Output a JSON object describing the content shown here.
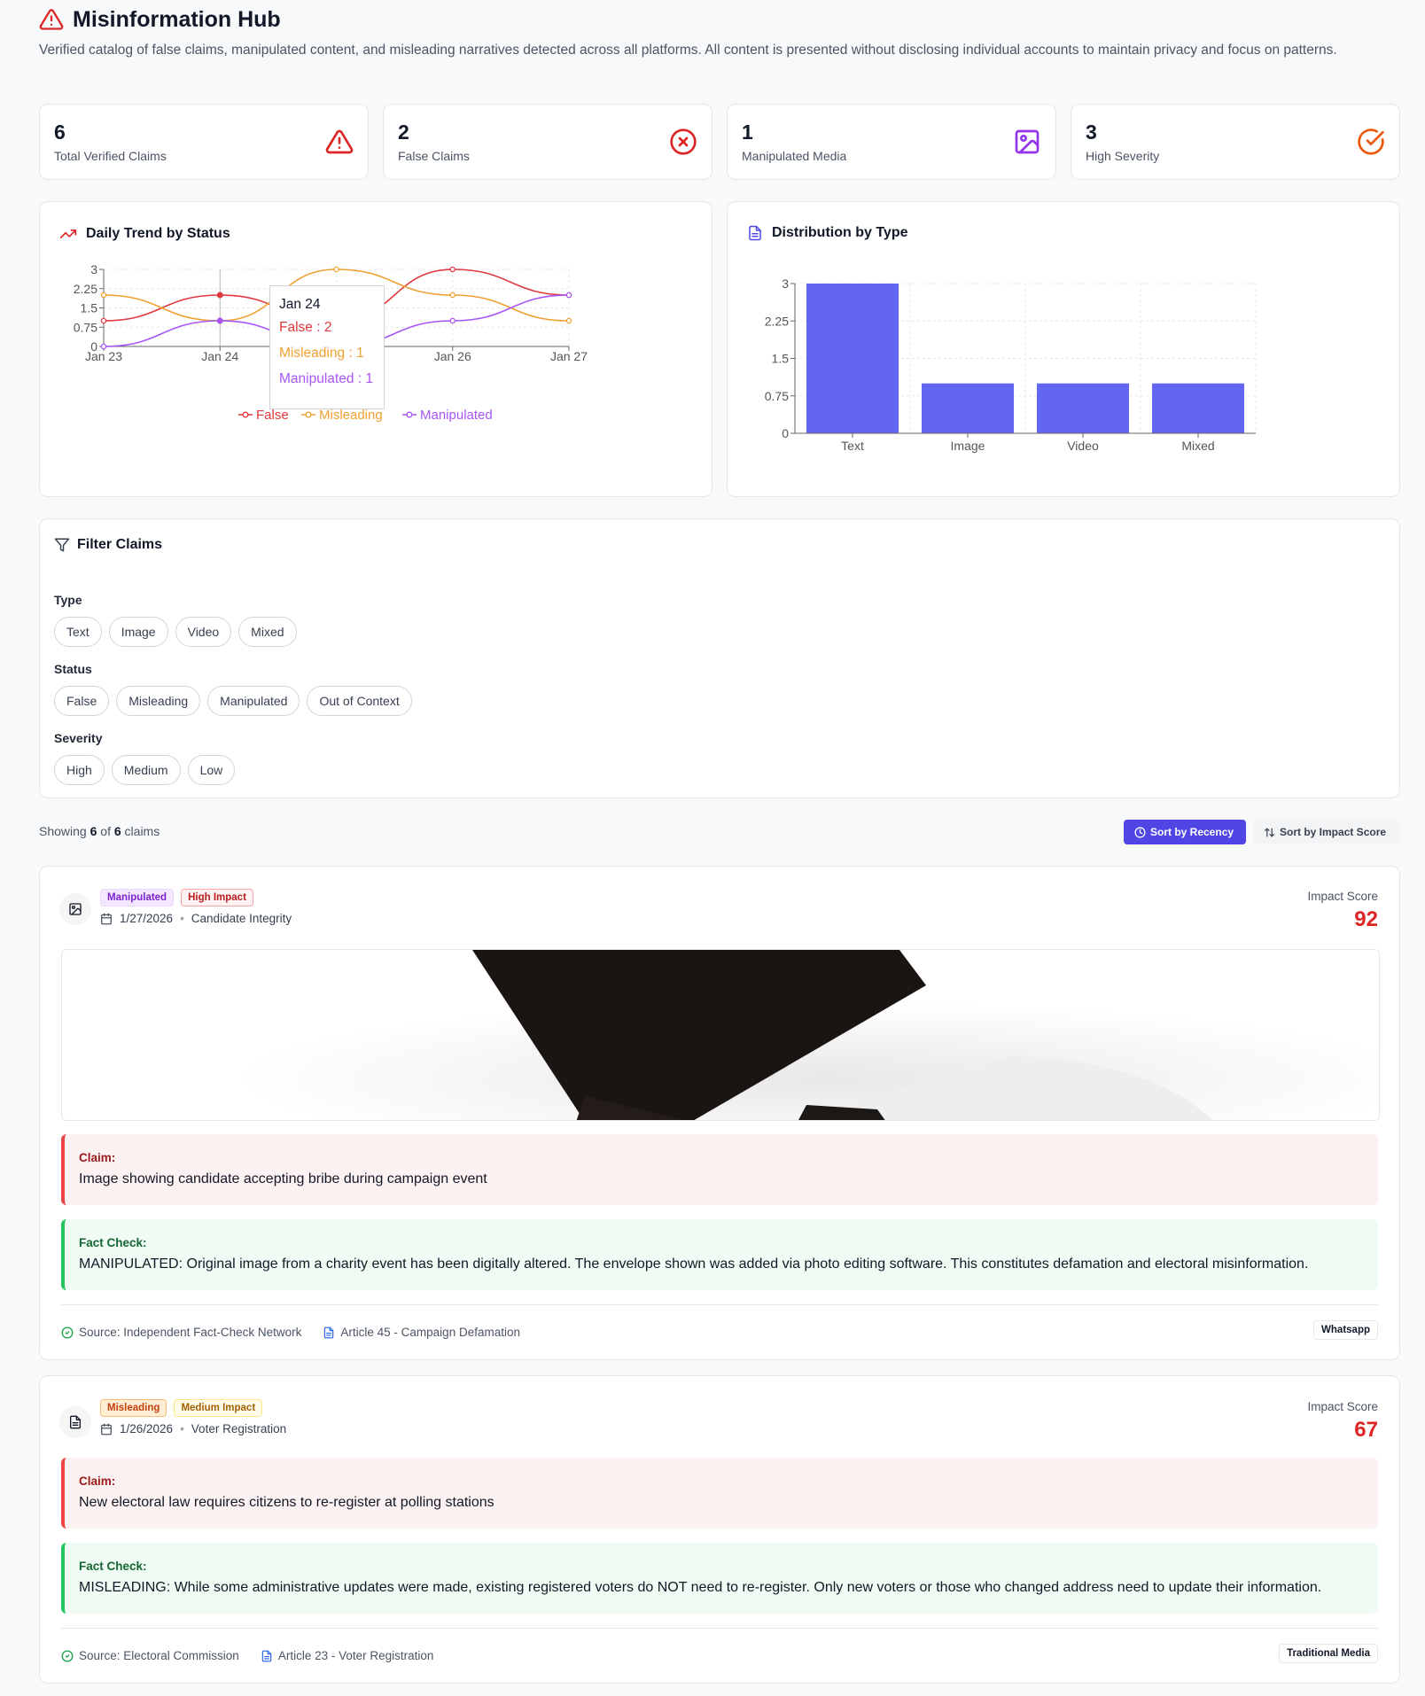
{
  "header": {
    "title": "Misinformation Hub",
    "subtitle": "Verified catalog of false claims, manipulated content, and misleading narratives detected across all platforms. All content is presented without disclosing individual accounts to maintain privacy and focus on patterns."
  },
  "stats": [
    {
      "value": "6",
      "label": "Total Verified Claims",
      "icon": "warning-triangle-icon",
      "color": "#dc2626"
    },
    {
      "value": "2",
      "label": "False Claims",
      "icon": "x-circle-icon",
      "color": "#dc2626"
    },
    {
      "value": "1",
      "label": "Manipulated Media",
      "icon": "image-icon",
      "color": "#9333ea"
    },
    {
      "value": "3",
      "label": "High Severity",
      "icon": "check-circle-icon",
      "color": "#ea580c"
    }
  ],
  "trend": {
    "title": "Daily Trend by Status",
    "tooltip": {
      "date": "Jan 24",
      "false": "False : 2",
      "misleading": "Misleading : 1",
      "manipulated": "Manipulated : 1"
    }
  },
  "distribution": {
    "title": "Distribution by Type"
  },
  "chart_data": [
    {
      "type": "line",
      "title": "Daily Trend by Status",
      "x": [
        "Jan 23",
        "Jan 24",
        "Jan 25",
        "Jan 26",
        "Jan 27"
      ],
      "y_ticks": [
        "0",
        "0.75",
        "1.5",
        "2.25",
        "3"
      ],
      "ylim": [
        0,
        3
      ],
      "series": [
        {
          "name": "False",
          "values": [
            1,
            2,
            1,
            3,
            2
          ],
          "color": "#e0393e"
        },
        {
          "name": "Misleading",
          "values": [
            2,
            1,
            3,
            2,
            1
          ],
          "color": "#f0a030"
        },
        {
          "name": "Manipulated",
          "values": [
            0,
            1,
            0,
            1,
            2
          ],
          "color": "#a855f7"
        }
      ],
      "grid": true,
      "legend": "bottom"
    },
    {
      "type": "bar",
      "title": "Distribution by Type",
      "categories": [
        "Text",
        "Image",
        "Video",
        "Mixed"
      ],
      "values": [
        3,
        1,
        1,
        1
      ],
      "y_ticks": [
        "0",
        "0.75",
        "1.5",
        "2.25",
        "3"
      ],
      "ylim": [
        0,
        3
      ],
      "color": "#6366f1",
      "grid": true
    }
  ],
  "filters": {
    "title": "Filter Claims",
    "type_label": "Type",
    "type_options": [
      "Text",
      "Image",
      "Video",
      "Mixed"
    ],
    "status_label": "Status",
    "status_options": [
      "False",
      "Misleading",
      "Manipulated",
      "Out of Context"
    ],
    "severity_label": "Severity",
    "severity_options": [
      "High",
      "Medium",
      "Low"
    ]
  },
  "results": {
    "showing_prefix": "Showing",
    "shown": "6",
    "of": "of",
    "total": "6",
    "suffix": "claims",
    "sort_recency": "Sort by Recency",
    "sort_impact": "Sort by Impact Score"
  },
  "claims": [
    {
      "status_badge": "Manipulated",
      "impact_badge": "High Impact",
      "date": "1/27/2026",
      "category": "Candidate Integrity",
      "impact_label": "Impact Score",
      "impact_score": "92",
      "claim_title": "Claim:",
      "claim_text": "Image showing candidate accepting bribe during campaign event",
      "fact_title": "Fact Check:",
      "fact_text": "MANIPULATED: Original image from a charity event has been digitally altered. The envelope shown was added via photo editing software. This constitutes defamation and electoral misinformation.",
      "source": "Source: Independent Fact-Check Network",
      "article": "Article 45 - Campaign Defamation",
      "platform": "Whatsapp"
    },
    {
      "status_badge": "Misleading",
      "impact_badge": "Medium Impact",
      "date": "1/26/2026",
      "category": "Voter Registration",
      "impact_label": "Impact Score",
      "impact_score": "67",
      "claim_title": "Claim:",
      "claim_text": "New electoral law requires citizens to re-register at polling stations",
      "fact_title": "Fact Check:",
      "fact_text": "MISLEADING: While some administrative updates were made, existing registered voters do NOT need to re-register. Only new voters or those who changed address need to update their information.",
      "source": "Source: Electoral Commission",
      "article": "Article 23 - Voter Registration",
      "platform": "Traditional Media"
    }
  ]
}
